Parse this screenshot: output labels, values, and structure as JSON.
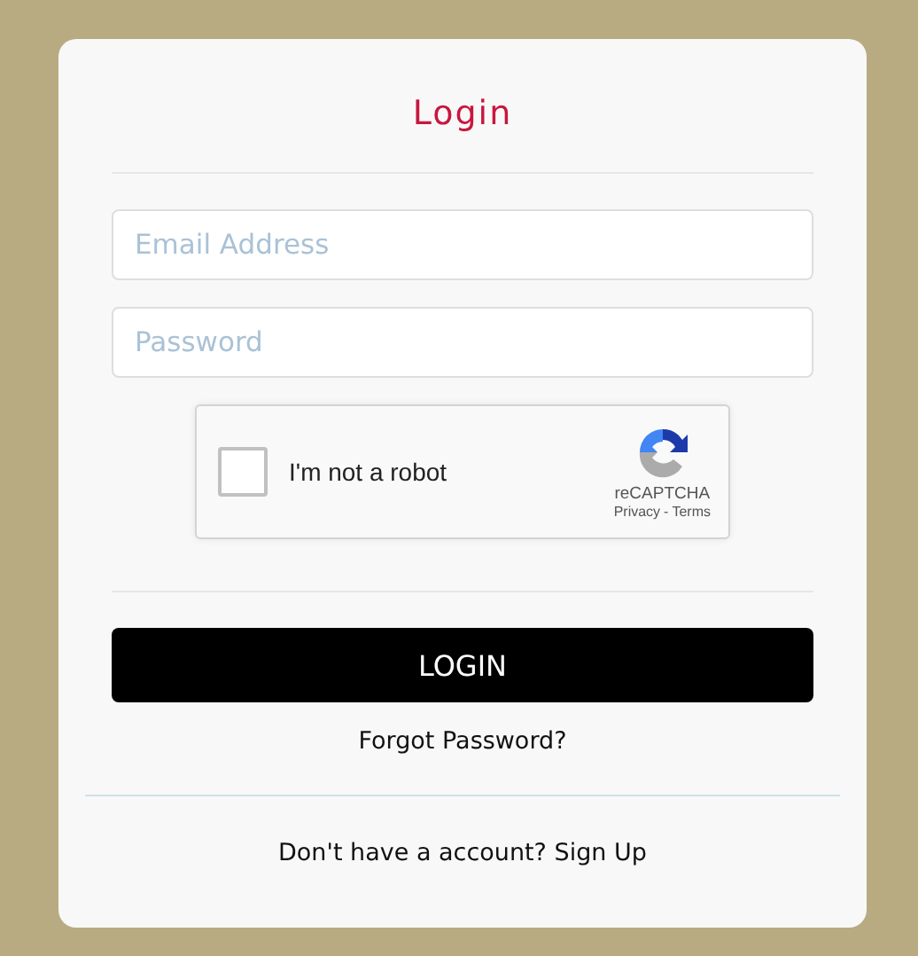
{
  "title": "Login",
  "email_field": {
    "placeholder": "Email Address"
  },
  "password_field": {
    "placeholder": "Password"
  },
  "captcha": {
    "label": "I'm not a robot",
    "checked": false,
    "brand": "reCAPTCHA",
    "privacy": "Privacy",
    "separator": "-",
    "terms": "Terms"
  },
  "login_button": "LOGIN",
  "forgot_link": "Forgot Password?",
  "signup_link": "Don't have a account? Sign Up"
}
